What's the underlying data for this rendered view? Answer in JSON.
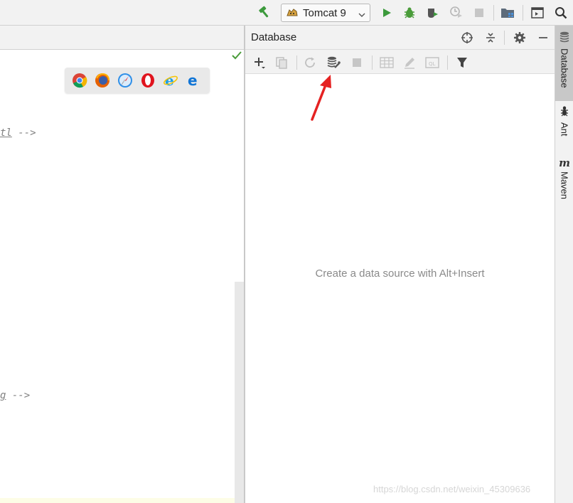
{
  "toolbar": {
    "run_config": "Tomcat 9",
    "icons": [
      "build-hammer-icon",
      "tomcat-cat-icon",
      "chevron-down-icon",
      "run-icon",
      "debug-icon",
      "coverage-icon",
      "profile-icon",
      "stop-icon",
      "project-structure-icon",
      "tool-window-icon",
      "search-icon"
    ]
  },
  "editor": {
    "line1_tag": "tl",
    "line1_suffix": " -->",
    "line2_tag": "g",
    "line2_suffix": " -->"
  },
  "browsers": [
    "chrome-icon",
    "firefox-icon",
    "safari-icon",
    "opera-icon",
    "ie-icon",
    "edge-icon"
  ],
  "database": {
    "title": "Database",
    "empty_text": "Create a data source with Alt+Insert"
  },
  "right_strip": {
    "tabs": [
      {
        "label": "Database",
        "active": true
      },
      {
        "label": "Ant",
        "active": false
      },
      {
        "label": "Maven",
        "active": false
      }
    ]
  },
  "watermark": "https://blog.csdn.net/weixin_45309636",
  "colors": {
    "accent_green": "#3c9a3c",
    "debug_green": "#4a9c3a",
    "arrow_red": "#e52222",
    "panel_bg": "#f2f2f2"
  }
}
